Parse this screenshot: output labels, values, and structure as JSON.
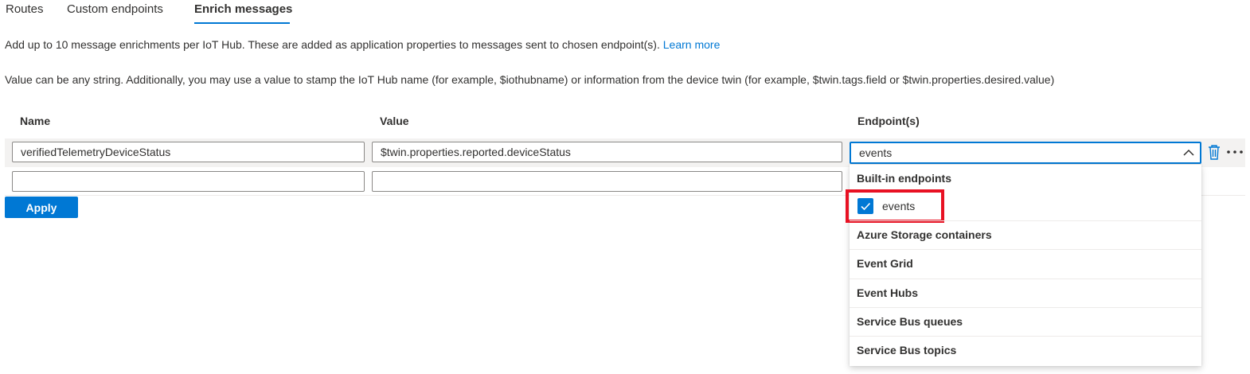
{
  "tabs": [
    {
      "label": "Routes"
    },
    {
      "label": "Custom endpoints"
    },
    {
      "label": "Enrich messages"
    }
  ],
  "description": {
    "line1": "Add up to 10 message enrichments per IoT Hub. These are added as application properties to messages sent to chosen endpoint(s).",
    "learn_more": "Learn more",
    "line2": "Value can be any string. Additionally, you may use a value to stamp the IoT Hub name (for example, $iothubname) or information from the device twin (for example, $twin.tags.field or $twin.properties.desired.value)"
  },
  "table": {
    "headers": {
      "name": "Name",
      "value": "Value",
      "endpoints": "Endpoint(s)"
    },
    "rows": [
      {
        "name": "verifiedTelemetryDeviceStatus",
        "value": "$twin.properties.reported.deviceStatus",
        "endpoints": "events"
      },
      {
        "name": "",
        "value": "",
        "endpoints": ""
      }
    ]
  },
  "apply_label": "Apply",
  "dropdown_menu": {
    "header": "Built-in endpoints",
    "selected_option": {
      "label": "events",
      "checked": true
    },
    "groups": [
      "Azure Storage containers",
      "Event Grid",
      "Event Hubs",
      "Service Bus queues",
      "Service Bus topics"
    ]
  },
  "colors": {
    "accent": "#0078d4",
    "highlight": "#e81123"
  }
}
